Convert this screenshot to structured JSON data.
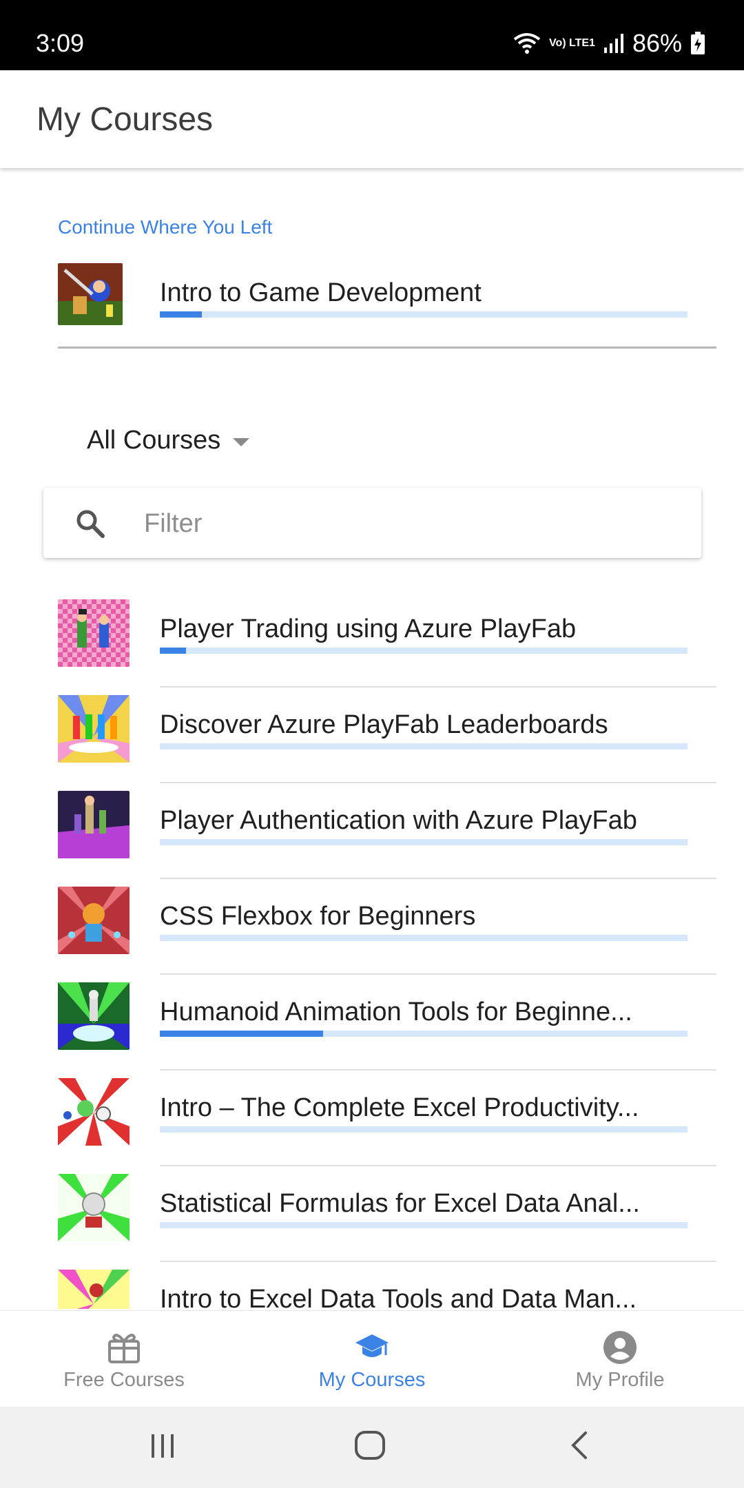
{
  "status_bar": {
    "time": "3:09",
    "battery": "86%",
    "network_label": "Vo) LTE1"
  },
  "app_bar": {
    "title": "My Courses"
  },
  "continue_section": {
    "label": "Continue Where You Left",
    "course": {
      "title": "Intro to Game Development",
      "progress": 0.08
    }
  },
  "filter": {
    "dropdown_label": "All Courses",
    "placeholder": "Filter",
    "value": ""
  },
  "courses": [
    {
      "title": "Player Trading using Azure PlayFab",
      "progress": 0.05
    },
    {
      "title": "Discover Azure PlayFab Leaderboards",
      "progress": 0.0
    },
    {
      "title": "Player Authentication with Azure PlayFab",
      "progress": 0.0
    },
    {
      "title": "CSS Flexbox for Beginners",
      "progress": 0.0
    },
    {
      "title": "Humanoid Animation Tools for Beginne...",
      "progress": 0.31
    },
    {
      "title": "Intro – The Complete Excel Productivity...",
      "progress": 0.0
    },
    {
      "title": "Statistical Formulas for Excel Data Anal...",
      "progress": 0.0
    },
    {
      "title": "Intro to Excel Data Tools and Data Man...",
      "progress": 0.0
    }
  ],
  "bottom_nav": {
    "items": [
      {
        "label": "Free Courses",
        "icon": "gift-icon",
        "active": false
      },
      {
        "label": "My Courses",
        "icon": "graduation-cap-icon",
        "active": true
      },
      {
        "label": "My Profile",
        "icon": "account-circle-icon",
        "active": false
      }
    ]
  },
  "colors": {
    "accent": "#3b82e6",
    "progress_track": "#d6e6fb",
    "inactive": "#8a8a8a"
  }
}
